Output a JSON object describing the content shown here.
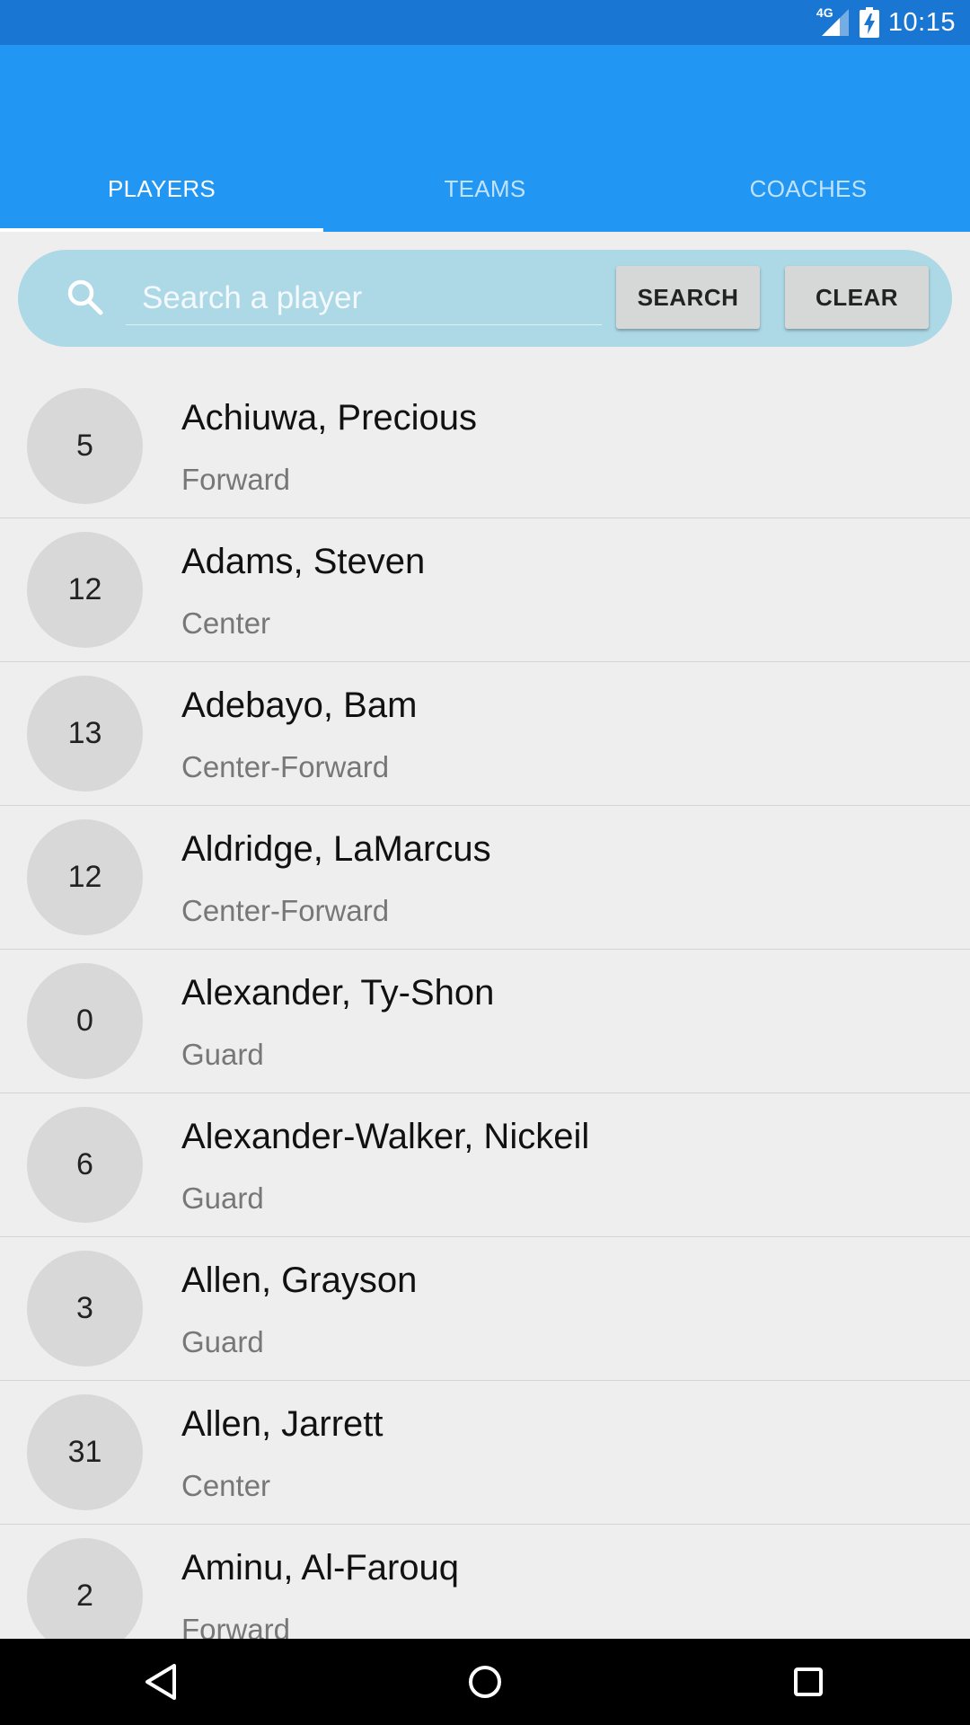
{
  "status_bar": {
    "time": "10:15",
    "network": "4G",
    "signal_icon": "signal-icon",
    "battery_icon": "battery-charging-icon"
  },
  "tabs": [
    {
      "label": "PLAYERS",
      "active": true
    },
    {
      "label": "TEAMS",
      "active": false
    },
    {
      "label": "COACHES",
      "active": false
    }
  ],
  "search": {
    "placeholder": "Search a player",
    "value": "",
    "search_button": "SEARCH",
    "clear_button": "CLEAR"
  },
  "players": [
    {
      "number": "5",
      "name": "Achiuwa, Precious",
      "position": "Forward"
    },
    {
      "number": "12",
      "name": "Adams, Steven",
      "position": "Center"
    },
    {
      "number": "13",
      "name": "Adebayo, Bam",
      "position": "Center-Forward"
    },
    {
      "number": "12",
      "name": "Aldridge, LaMarcus",
      "position": "Center-Forward"
    },
    {
      "number": "0",
      "name": "Alexander, Ty-Shon",
      "position": "Guard"
    },
    {
      "number": "6",
      "name": "Alexander-Walker, Nickeil",
      "position": "Guard"
    },
    {
      "number": "3",
      "name": "Allen, Grayson",
      "position": "Guard"
    },
    {
      "number": "31",
      "name": "Allen, Jarrett",
      "position": "Center"
    },
    {
      "number": "2",
      "name": "Aminu, Al-Farouq",
      "position": "Forward"
    }
  ],
  "nav_bar": {
    "back_icon": "back-icon",
    "home_icon": "home-icon",
    "recents_icon": "recents-icon"
  },
  "colors": {
    "status_bar": "#1976d2",
    "app_bar": "#2196f3",
    "search_bar": "#add8e6",
    "background": "#eeeeee"
  }
}
